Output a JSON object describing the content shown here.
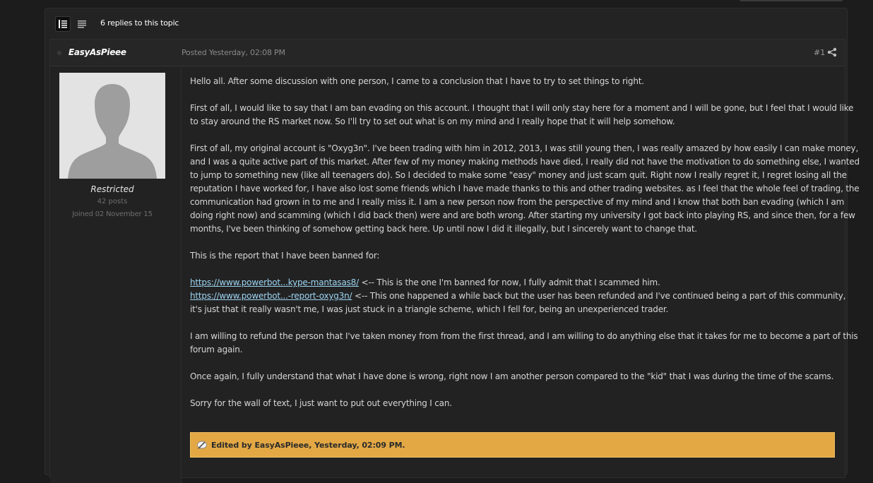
{
  "topic": {
    "replies_text": "6 replies to this topic"
  },
  "post": {
    "author": "EasyAsPieee",
    "posted": "Posted Yesterday, 02:08 PM",
    "number": "#1",
    "member_group": "Restricted",
    "post_count": "42 posts",
    "joined": "Joined 02 November 15",
    "paragraphs": {
      "p1": [
        "Hello all. After some discussion with one person, I came to a conclusion that I have to try to set things to right."
      ],
      "p2": [
        "First of all, I would like to say that I am ban evading on this account. I thought that I will only stay here for a moment and I will be gone, but I feel that I would like",
        "to stay around the RS market now. So I'll try to set out what is on my mind and I really hope that it will help somehow."
      ],
      "p3": [
        "First of all, my original account is \"Oxyg3n\". I've been trading with him in 2012, 2013, I was still young then, I was really amazed by how easily I can make money,",
        "and I was a quite active part of this market. After few of my money making methods have died, I really did not have the motivation to do something else, I wanted",
        "to jump to something new (like all teenagers do). So I decided to make some \"easy\" money and just scam quit. Right now I really regret it, I regret losing all the",
        "reputation I have worked for, I have also lost some friends which I have made thanks to this and other trading websites. as I feel that the whole feel of trading, the",
        "communication had grown in to me and I really miss it. I am a new person now from the perspective of my mind and I know that both ban evading (which I am",
        "doing right now) and scamming (which I did back then) were and are both wrong. After starting my university I got back into playing RS, and since then, for a few",
        "months, I've been thinking of somehow getting back here. Up until now I did it illegally, but I sincerely want to change that."
      ],
      "p4": [
        "This is the report that I have been banned for:"
      ],
      "link1_text": "https://www.powerbot...kype-mantasas8/",
      "link1_after": " <-- This is the one I'm banned for now, I fully admit that I scammed him.",
      "link2_text": "https://www.powerbot...-report-oxyg3n/",
      "link2_after": " <-- This one happened a while back but the user has been refunded and I've continued being a part of this community,",
      "link2_cont": "it's just that it really wasn't me, I was just stuck in a triangle scheme, which I fell for, being an unexperienced trader.",
      "p6": [
        "I am willing to refund the person that I've taken money from from the first thread, and I am willing to do anything else that it takes for me to become a part of this",
        "forum again."
      ],
      "p7": [
        "Once again, I fully understand that what I have done is wrong, right now I am another person compared to the \"kid\" that I was during the time of the scams."
      ],
      "p8": [
        "Sorry for the wall of text, I just want to put out everything I can."
      ]
    },
    "edited_text": "Edited by EasyAsPieee, Yesterday, 02:09 PM."
  },
  "icons": {
    "view_full": "list-detail-icon",
    "view_compact": "list-compact-icon",
    "share": "share-icon",
    "avatar": "default-avatar-silhouette",
    "edit": "edit-note-icon"
  },
  "colors": {
    "background": "#1c1c1c",
    "link": "#9cd4f2",
    "edit_bar": "#e3a844"
  }
}
